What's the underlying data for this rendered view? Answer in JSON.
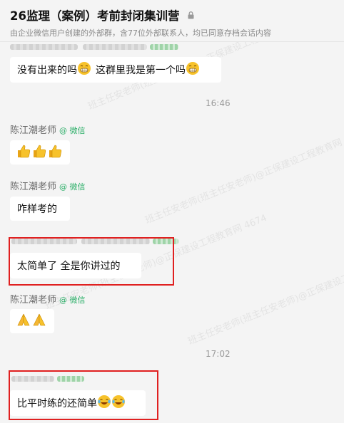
{
  "header": {
    "title": "26监理（案例）考前封闭集训营",
    "subtitle": "由企业微信用户创建的外部群，含77位外部联系人，均已同意存档会话内容"
  },
  "wechat_tag": "@ 微信",
  "watermark": "班主任安老师(班主任安老师)@正保建设工程教育网 4674",
  "messages": [
    {
      "text": "没有出来的吗"
    },
    {
      "text": "这群里我是第一个吗"
    },
    {
      "time": "16:46"
    },
    {
      "sender": "陈江潮老师"
    },
    {
      "sender": "陈江潮老师",
      "text": "咋样考的"
    },
    {
      "text": "太简单了 全是你讲过的"
    },
    {
      "sender": "陈江潮老师"
    },
    {
      "time": "17:02"
    },
    {
      "text": "比平时练的还简单"
    }
  ]
}
